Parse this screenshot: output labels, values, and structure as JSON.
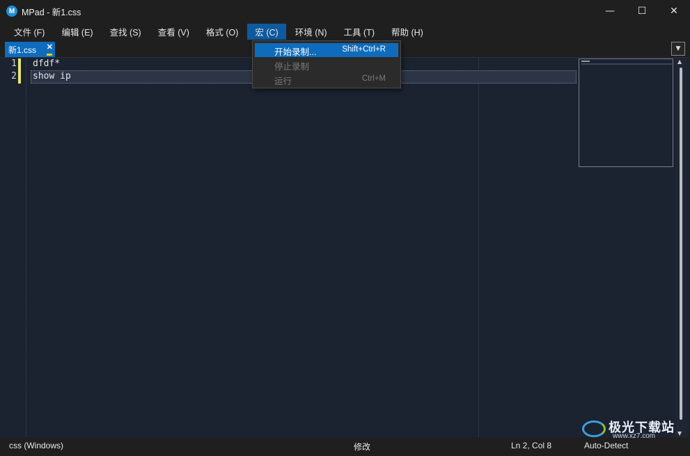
{
  "window": {
    "app_icon_letter": "M",
    "title": "MPad - 新1.css",
    "minimize_glyph": "—",
    "maximize_glyph": "☐",
    "close_glyph": "✕"
  },
  "menu": [
    {
      "label": "文件 (F)"
    },
    {
      "label": "编辑 (E)"
    },
    {
      "label": "查找 (S)"
    },
    {
      "label": "查看 (V)"
    },
    {
      "label": "格式 (O)"
    },
    {
      "label": "宏 (C)"
    },
    {
      "label": "环境 (N)"
    },
    {
      "label": "工具 (T)"
    },
    {
      "label": "帮助 (H)"
    }
  ],
  "macro_menu": {
    "items": [
      {
        "label": "开始录制...",
        "shortcut": "Shift+Ctrl+R"
      },
      {
        "label": "停止录制",
        "shortcut": ""
      },
      {
        "label": "运行",
        "shortcut": "Ctrl+M"
      }
    ]
  },
  "tab": {
    "label": "新1.css",
    "close_glyph": "✕"
  },
  "editor": {
    "lines": [
      {
        "num": "1",
        "text": "dfdf*"
      },
      {
        "num": "2",
        "text": "show ip"
      }
    ]
  },
  "status": {
    "syntax": "css (Windows)",
    "state": "修改",
    "position": "Ln 2, Col 8",
    "encoding": "Auto-Detect"
  },
  "watermark": {
    "text": "极光下载站",
    "url": "www.xz7.com"
  },
  "colors": {
    "accent": "#0f6cbd",
    "editor_bg": "#1b2230",
    "modified_marker": "#e8e870"
  }
}
